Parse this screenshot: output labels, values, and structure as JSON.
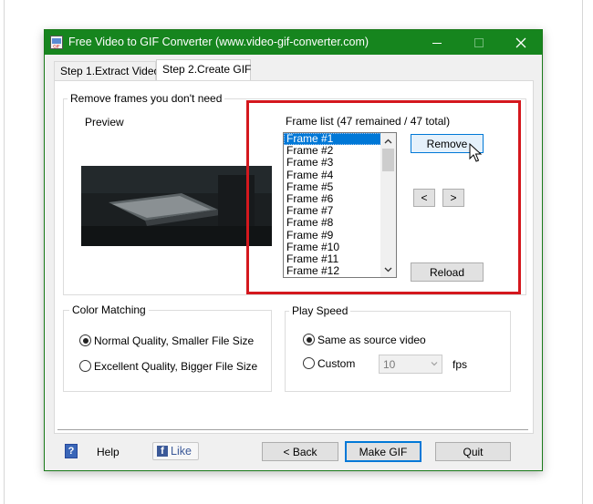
{
  "window": {
    "title": "Free Video to GIF Converter (www.video-gif-converter.com)",
    "accent_color": "#16851e",
    "controls": [
      "minimize-icon",
      "maximize-icon",
      "close-icon"
    ]
  },
  "tabs": [
    {
      "label": "Step 1.Extract Video",
      "selected": false
    },
    {
      "label": "Step 2.Create GIF",
      "selected": true
    }
  ],
  "remove_frames": {
    "group_title": "Remove frames you don't need",
    "preview_label": "Preview",
    "frame_list_label": "Frame list (47 remained / 47 total)",
    "frames": [
      "Frame #1",
      "Frame #2",
      "Frame #3",
      "Frame #4",
      "Frame #5",
      "Frame #6",
      "Frame #7",
      "Frame #8",
      "Frame #9",
      "Frame #10",
      "Frame #11",
      "Frame #12"
    ],
    "selected_frame": "Frame #1",
    "remove_label": "Remove",
    "prev_label": "<",
    "next_label": ">",
    "reload_label": "Reload"
  },
  "color_matching": {
    "group_title": "Color Matching",
    "options": [
      {
        "label": "Normal Quality, Smaller File Size",
        "checked": true
      },
      {
        "label": "Excellent Quality, Bigger File Size",
        "checked": false
      }
    ]
  },
  "play_speed": {
    "group_title": "Play Speed",
    "same_as_source_label": "Same as source video",
    "same_as_source_checked": true,
    "custom_label": "Custom",
    "custom_checked": false,
    "fps_value": "10",
    "fps_unit": "fps"
  },
  "footer": {
    "help_label": "Help",
    "help_icon_glyph": "?",
    "like_label": "Like",
    "facebook_glyph": "f",
    "back_label": "< Back",
    "make_gif_label": "Make GIF",
    "quit_label": "Quit"
  },
  "annotation_color": "#d4181e"
}
